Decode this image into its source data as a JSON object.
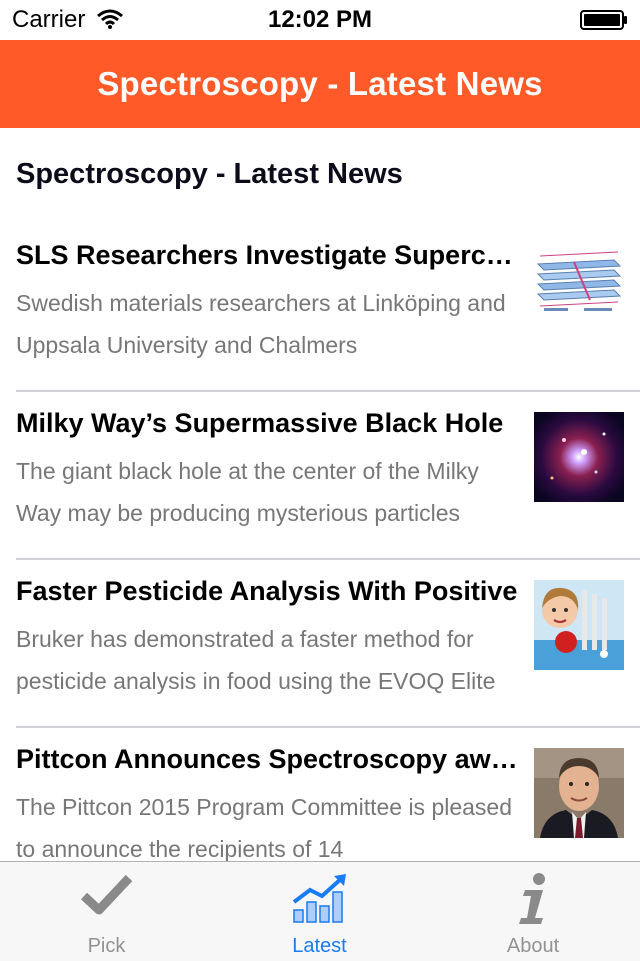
{
  "status_bar": {
    "carrier": "Carrier",
    "time": "12:02 PM"
  },
  "nav": {
    "title": "Spectroscopy - Latest News",
    "bar_color": "#ff5a28"
  },
  "content": {
    "heading": "Spectroscopy - Latest News",
    "items": [
      {
        "headline": "SLS Researchers Investigate Superconductors",
        "summary": "Swedish materials researchers at Linköping and Uppsala University and Chalmers",
        "thumb": "layered-materials-diagram"
      },
      {
        "headline": "Milky Way’s Supermassive Black Hole",
        "summary": "The giant black hole at the center of the Milky Way may be producing mysterious particles",
        "thumb": "galactic-center-photo"
      },
      {
        "headline": "Faster Pesticide Analysis With Positive",
        "summary": "Bruker has demonstrated a faster method for pesticide analysis in food using the EVOQ Elite",
        "thumb": "girl-with-apple-photo"
      },
      {
        "headline": "Pittcon Announces Spectroscopy awards",
        "summary": "The Pittcon 2015 Program Committee is pleased to announce the recipients of 14",
        "thumb": "man-portrait-photo"
      }
    ]
  },
  "tabs": [
    {
      "label": "Pick",
      "icon": "checkmark-icon",
      "active": false
    },
    {
      "label": "Latest",
      "icon": "trending-chart-icon",
      "active": true
    },
    {
      "label": "About",
      "icon": "info-icon",
      "active": false
    }
  ],
  "colors": {
    "accent": "#1a7cf4",
    "inactive_tab": "#929292",
    "summary_text": "#777777"
  }
}
